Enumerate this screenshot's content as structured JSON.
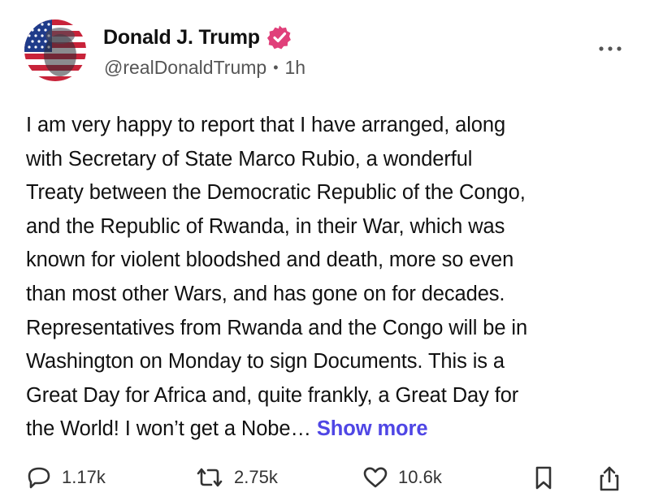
{
  "post": {
    "author": {
      "display_name": "Donald J. Trump",
      "handle": "@realDonaldTrump",
      "time_ago": "1h",
      "verified_color": "#e0407a"
    },
    "body_lines": [
      "I am very happy to report that I have arranged, along",
      "with Secretary of State Marco Rubio, a wonderful",
      "Treaty between the Democratic Republic of the Congo,",
      "and the Republic of Rwanda, in their War, which was",
      "known for violent bloodshed and death, more so even",
      "than most other Wars, and has gone on for decades.",
      "Representatives from Rwanda and the Congo will be in",
      "Washington on Monday to sign Documents. This is a",
      "Great Day for Africa and, quite frankly, a Great Day for",
      "the World! I won’t get a Nobe…"
    ],
    "show_more_label": "Show more",
    "show_more_color": "#4f46e5"
  },
  "actions": {
    "replies": "1.17k",
    "reposts": "2.75k",
    "likes": "10.6k"
  },
  "icons": [
    "more-options-icon",
    "verified-badge-icon",
    "reply-icon",
    "repost-icon",
    "like-icon",
    "bookmark-icon",
    "share-icon"
  ]
}
